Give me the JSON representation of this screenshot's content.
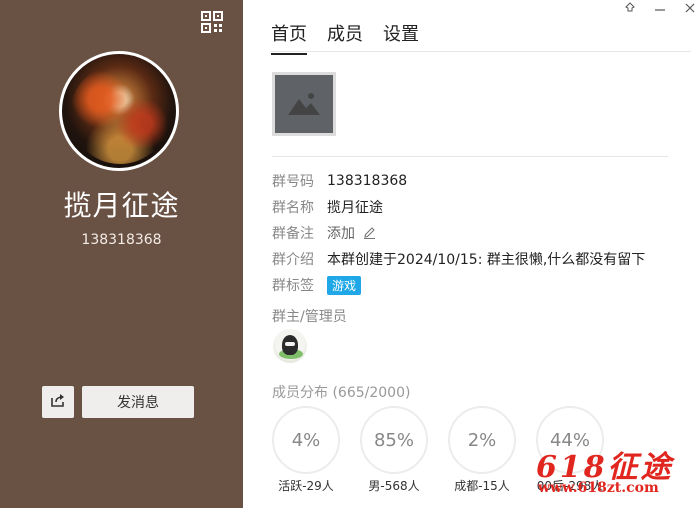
{
  "left": {
    "group_name": "揽月征途",
    "group_id": "138318368",
    "send_message_label": "发消息",
    "icons": {
      "qr": "qr-code-icon",
      "share": "share-icon"
    }
  },
  "window": {
    "icons": [
      "pin-icon",
      "minimize-icon",
      "close-icon"
    ]
  },
  "tabs": [
    {
      "label": "首页",
      "active": true
    },
    {
      "label": "成员",
      "active": false
    },
    {
      "label": "设置",
      "active": false
    }
  ],
  "info": {
    "number_label": "群号码",
    "number_value": "138318368",
    "name_label": "群名称",
    "name_value": "揽月征途",
    "remark_label": "群备注",
    "remark_value": "添加",
    "intro_label": "群介绍",
    "intro_value": "本群创建于2024/10/15:  群主很懒,什么都没有留下",
    "tags_label": "群标签",
    "tag_value": "游戏"
  },
  "admins_title": "群主/管理员",
  "distribution": {
    "title": "成员分布 (665/2000)",
    "items": [
      {
        "value": "4%",
        "label": "活跃-29人"
      },
      {
        "value": "85%",
        "label": "男-568人"
      },
      {
        "value": "2%",
        "label": "成都-15人"
      },
      {
        "value": "44%",
        "label": "00后-298人"
      }
    ]
  },
  "watermark": {
    "big": "618征途",
    "url": "www.618zt.com"
  },
  "colors": {
    "left_panel": "#695144",
    "tag": "#1fa7e8",
    "watermark": "#e0261f"
  }
}
